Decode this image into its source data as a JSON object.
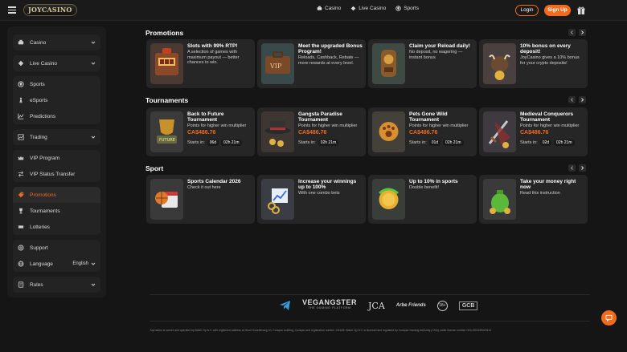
{
  "header": {
    "logo": "JOYCASINO",
    "nav": [
      {
        "label": "Casino",
        "icon": "casino-icon"
      },
      {
        "label": "Live Casino",
        "icon": "live-casino-icon"
      },
      {
        "label": "Sports",
        "icon": "sports-ball-icon"
      }
    ],
    "login_label": "Login",
    "signup_label": "Sign Up"
  },
  "sidebar": {
    "casino": "Casino",
    "live_casino": "Live Casino",
    "sports": "Sports",
    "esports": "eSports",
    "predictions": "Predictions",
    "trading": "Trading",
    "vip_program": "VIP Program",
    "vip_status_transfer": "VIP Status Transfer",
    "promotions": "Promotions",
    "tournaments": "Tournaments",
    "lotteries": "Lotteries",
    "support": "Support",
    "language": "Language",
    "language_value": "English",
    "rules": "Rules"
  },
  "sections": {
    "promotions": {
      "title": "Promotions",
      "cards": [
        {
          "title": "Slots with 99% RTP!",
          "desc": "A selection of games with maximum payout — better chances to win."
        },
        {
          "title": "Meet the upgraded Bonus Program!",
          "desc": "Reloads, Cashback, Rebate — more rewards at every level."
        },
        {
          "title": "Claim your Reload daily!",
          "desc": "No deposit, no wagering — instant bonus"
        },
        {
          "title": "10% bonus on every deposit!",
          "desc": "JoyCasino gives a 10% bonus for your crypto deposits!"
        }
      ]
    },
    "tournaments": {
      "title": "Tournaments",
      "starts_label": "Starts in:",
      "cards": [
        {
          "title": "Back to Future Tournament",
          "desc": "Points for higher win multiplier",
          "prize": "CA$486.76",
          "days": "06d",
          "time": "02h 21m"
        },
        {
          "title": "Gangsta Paradise Tournament",
          "desc": "Points for higher win multiplier",
          "prize": "CA$486.76",
          "days": "",
          "time": "02h 21m"
        },
        {
          "title": "Pets Gone Wild Tournament",
          "desc": "Points for higher win multiplier",
          "prize": "CA$486.76",
          "days": "01d",
          "time": "02h 21m"
        },
        {
          "title": "Medieval Conquerors Tournament",
          "desc": "Points for higher win multiplier",
          "prize": "CA$486.76",
          "days": "02d",
          "time": "02h 21m"
        }
      ]
    },
    "sport": {
      "title": "Sport",
      "cards": [
        {
          "title": "Sports Calendar 2026",
          "desc": "Check it out here"
        },
        {
          "title": "Increase your winnings up to 100%",
          "desc": "With one combo bets"
        },
        {
          "title": "Up to 10% in sports",
          "desc": "Double benefit!"
        },
        {
          "title": "Take your money right now",
          "desc": "Read this instruction"
        }
      ]
    }
  },
  "footer": {
    "partners": [
      "VEGANGSTER",
      "THE GAMING PLATFORM",
      "JCA",
      "Arbe Friends",
      "18+",
      "GCB"
    ],
    "legal": "JoyCasino is owned and operated by Batch Op N.V. with registered address at Groot Kwartierweg 10, Curaçao building, Curaçao and registration number 131628. Batch Op N.V. is licensed and regulated by Curaçao Gaming Authority (CGA) under license number OGL/2024/894/0412."
  },
  "colors": {
    "accent": "#f26b1d",
    "background": "#151515",
    "card": "#262626"
  }
}
